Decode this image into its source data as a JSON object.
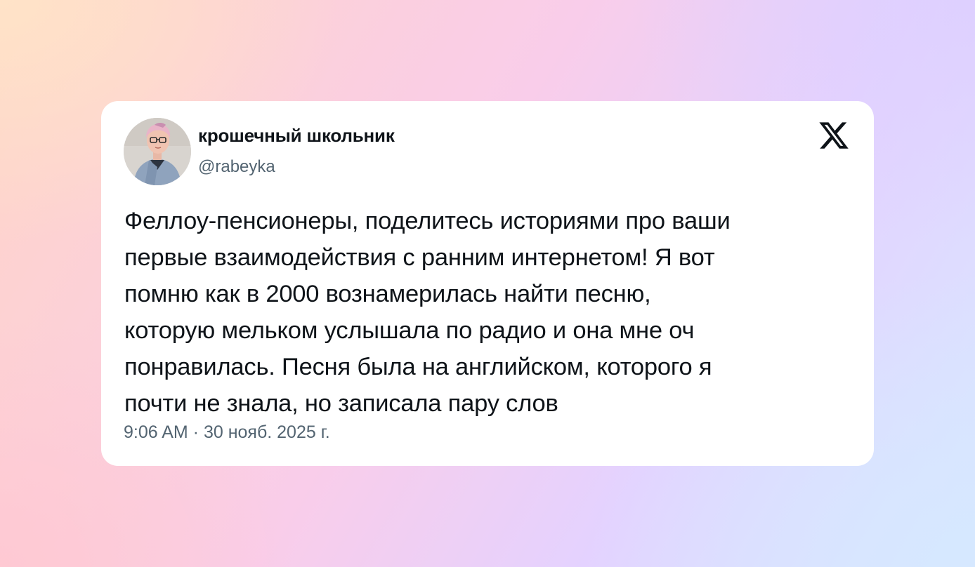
{
  "tweet": {
    "author_name": "крошечный школьник",
    "author_handle": "@rabeyka",
    "text": "Феллоу-пенсионеры, поделитесь историями про ваши\nпервые взаимодействия с ранним интернетом! Я вот\nпомню как в 2000 вознамерилась найти песню,\nкоторую мельком услышала по радио и она мне оч\nпонравилась. Песня была на английском, которого я\nпочти не знала, но записала пару слов",
    "timestamp": "9:06 AM · 30 нояб. 2025 г."
  },
  "icons": {
    "brand_logo": "x-logo-icon",
    "avatar": "avatar-photo"
  },
  "colors": {
    "primary_text": "#0f1419",
    "secondary_text": "#536471",
    "card_background": "#ffffff"
  }
}
